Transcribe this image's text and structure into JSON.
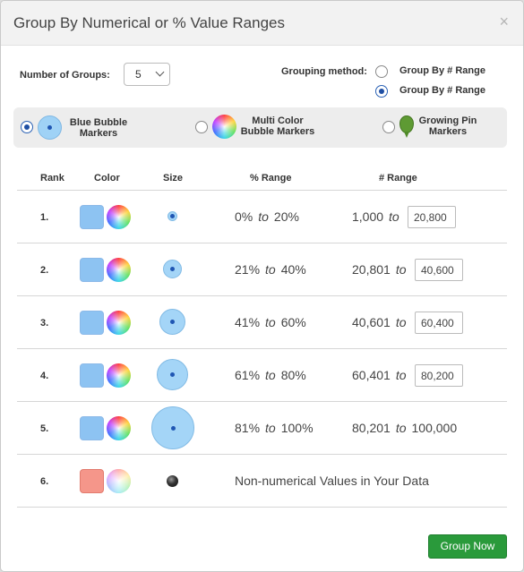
{
  "dialog": {
    "title": "Group By Numerical or % Value Ranges",
    "close_label": "×"
  },
  "controls": {
    "number_of_groups_label": "Number of Groups:",
    "number_of_groups_value": "5",
    "grouping_method_label": "Grouping method:",
    "grouping_options": [
      {
        "label": "Group By # Range",
        "checked": false
      },
      {
        "label": "Group By # Range",
        "checked": true
      }
    ]
  },
  "marker_types": [
    {
      "line1": "Blue Bubble",
      "line2": "Markers",
      "icon": "blue-bubble-icon",
      "checked": true
    },
    {
      "line1": "Multi Color",
      "line2": "Bubble Markers",
      "icon": "color-wheel-icon",
      "checked": false
    },
    {
      "line1": "Growing Pin",
      "line2": "Markers",
      "icon": "green-pin-icon",
      "checked": false
    }
  ],
  "table": {
    "headers": {
      "rank": "Rank",
      "color": "Color",
      "size": "Size",
      "pct_range": "% Range",
      "num_range": "# Range"
    },
    "to_word": "to",
    "rows": [
      {
        "rank": "1.",
        "pct_from": "0%",
        "pct_to": "20%",
        "num_from": "1,000",
        "num_to": "20,800"
      },
      {
        "rank": "2.",
        "pct_from": "21%",
        "pct_to": "40%",
        "num_from": "20,801",
        "num_to": "40,600"
      },
      {
        "rank": "3.",
        "pct_from": "41%",
        "pct_to": "60%",
        "num_from": "40,601",
        "num_to": "60,400"
      },
      {
        "rank": "4.",
        "pct_from": "61%",
        "pct_to": "80%",
        "num_from": "60,401",
        "num_to": "80,200"
      },
      {
        "rank": "5.",
        "pct_from": "81%",
        "pct_to": "100%",
        "num_from": "80,201",
        "num_to": "100,000"
      }
    ],
    "non_numeric_row": {
      "rank": "6.",
      "text": "Non-numerical Values in Your Data"
    }
  },
  "colors": {
    "blue_swatch": "#8dc3f2",
    "salmon_swatch": "#f5968a",
    "primary_button": "#2a9a3b"
  },
  "footer": {
    "group_now_label": "Group Now"
  }
}
